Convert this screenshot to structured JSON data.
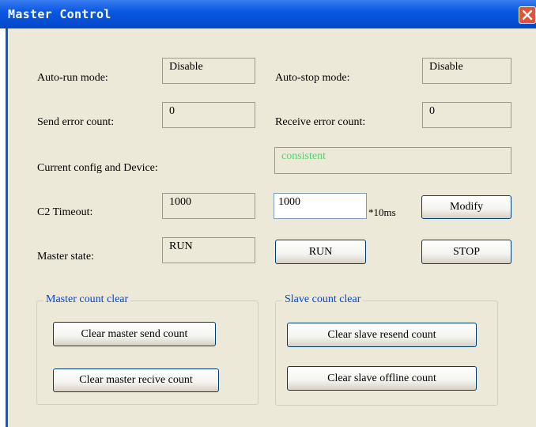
{
  "window": {
    "title": "Master Control"
  },
  "fields": {
    "auto_run_label": "Auto-run mode:",
    "auto_run_value": "Disable",
    "auto_stop_label": "Auto-stop mode:",
    "auto_stop_value": "Disable",
    "send_error_label": "Send error count:",
    "send_error_value": "0",
    "receive_error_label": "Receive error count:",
    "receive_error_value": "0",
    "config_label": "Current config and Device:",
    "config_value": "consistent",
    "c2_timeout_label": "C2 Timeout:",
    "c2_timeout_value": "1000",
    "c2_timeout_input": "1000",
    "c2_timeout_unit": "*10ms",
    "master_state_label": "Master state:",
    "master_state_value": "RUN"
  },
  "buttons": {
    "modify": "Modify",
    "run": "RUN",
    "stop": "STOP"
  },
  "master_group": {
    "legend": "Master count clear",
    "clear_send": "Clear master send count",
    "clear_receive": "Clear master recive count"
  },
  "slave_group": {
    "legend": "Slave count clear",
    "clear_resend": "Clear slave resend count",
    "clear_offline": "Clear slave offline count"
  },
  "colors": {
    "title_bar": "#0a58e2",
    "client_bg": "#ece9d8",
    "group_legend": "#0046d5",
    "consistent_text": "#4fd36a",
    "close_button": "#e0533a"
  }
}
